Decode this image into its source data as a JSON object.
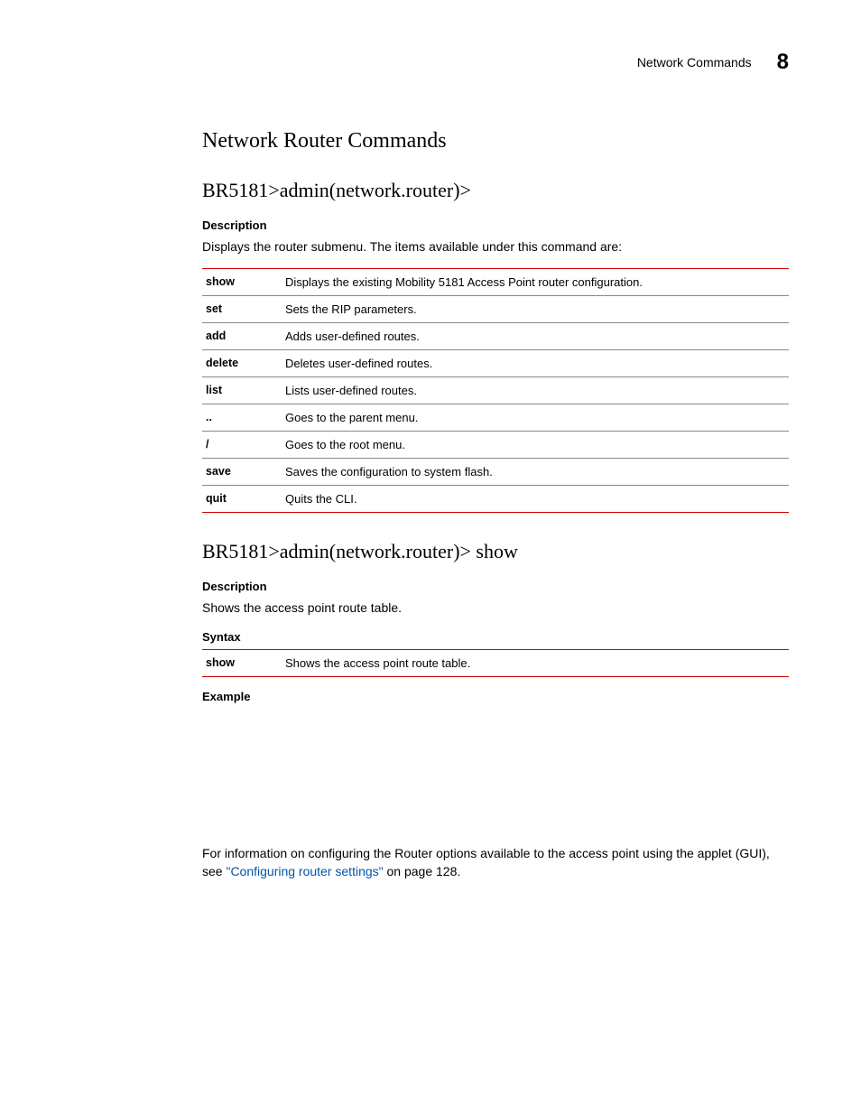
{
  "header": {
    "running_title": "Network Commands",
    "chapter_number": "8"
  },
  "section_title": "Network Router Commands",
  "block1": {
    "heading": "BR5181>admin(network.router)>",
    "desc_label": "Description",
    "desc_text": "Displays the router submenu. The items available under this command are:",
    "commands": [
      {
        "cmd": "show",
        "desc": "Displays the existing Mobility 5181 Access Point router configuration."
      },
      {
        "cmd": "set",
        "desc": "Sets the RIP parameters."
      },
      {
        "cmd": "add",
        "desc": "Adds user-defined routes."
      },
      {
        "cmd": "delete",
        "desc": "Deletes user-defined routes."
      },
      {
        "cmd": "list",
        "desc": "Lists user-defined routes."
      },
      {
        "cmd": "..",
        "desc": "Goes to the parent menu."
      },
      {
        "cmd": "/",
        "desc": "Goes to the root menu."
      },
      {
        "cmd": "save",
        "desc": "Saves the configuration to system flash."
      },
      {
        "cmd": "quit",
        "desc": "Quits the CLI."
      }
    ]
  },
  "block2": {
    "heading": "BR5181>admin(network.router)> show",
    "desc_label": "Description",
    "desc_text": "Shows the access point route table.",
    "syntax_label": "Syntax",
    "syntax_rows": [
      {
        "cmd": "show",
        "desc": "Shows the access point route table."
      }
    ],
    "example_label": "Example"
  },
  "footer_note": {
    "prefix": "For information on configuring the Router options available to the access point using the applet (GUI), see ",
    "link_text": "\"Configuring router settings\"",
    "suffix": " on page 128."
  }
}
